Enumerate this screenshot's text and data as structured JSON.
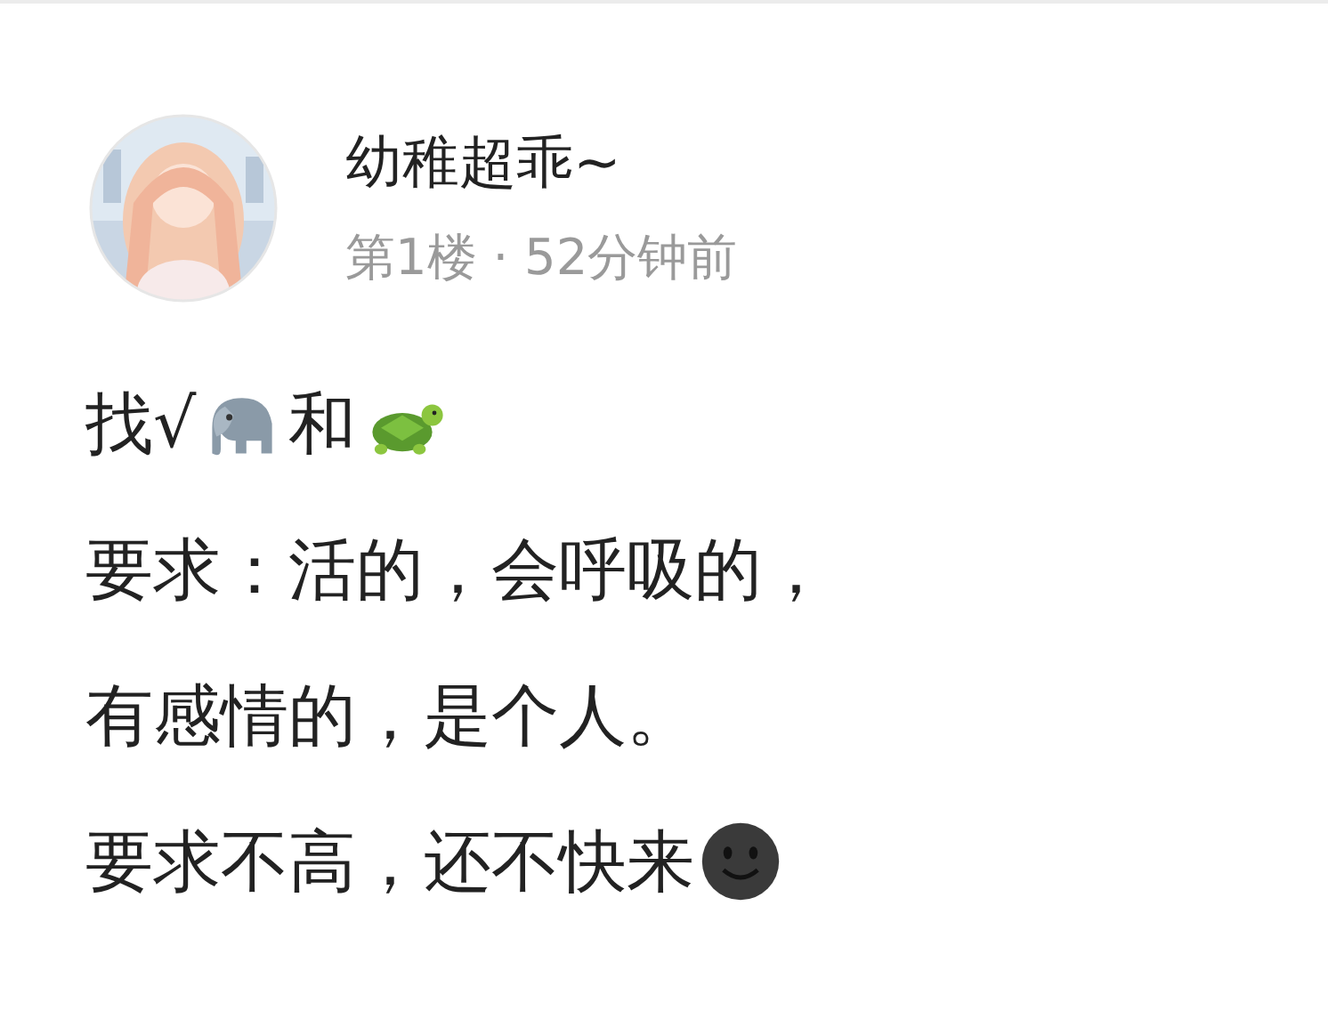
{
  "post": {
    "author": "幼稚超乖~",
    "meta": "第1楼 · 52分钟前",
    "avatar": {
      "kind": "picture"
    },
    "lines": [
      [
        {
          "kind": "text",
          "text": "找√"
        },
        {
          "kind": "elephant"
        },
        {
          "kind": "text",
          "text": "和"
        },
        {
          "kind": "turtle"
        }
      ],
      [
        {
          "kind": "text",
          "text": "要求：活的，会呼吸的，"
        }
      ],
      [
        {
          "kind": "text",
          "text": "有感情的，是个人。"
        }
      ],
      [
        {
          "kind": "text",
          "text": "要求不高，还不快来"
        },
        {
          "kind": "smiley"
        }
      ]
    ]
  }
}
